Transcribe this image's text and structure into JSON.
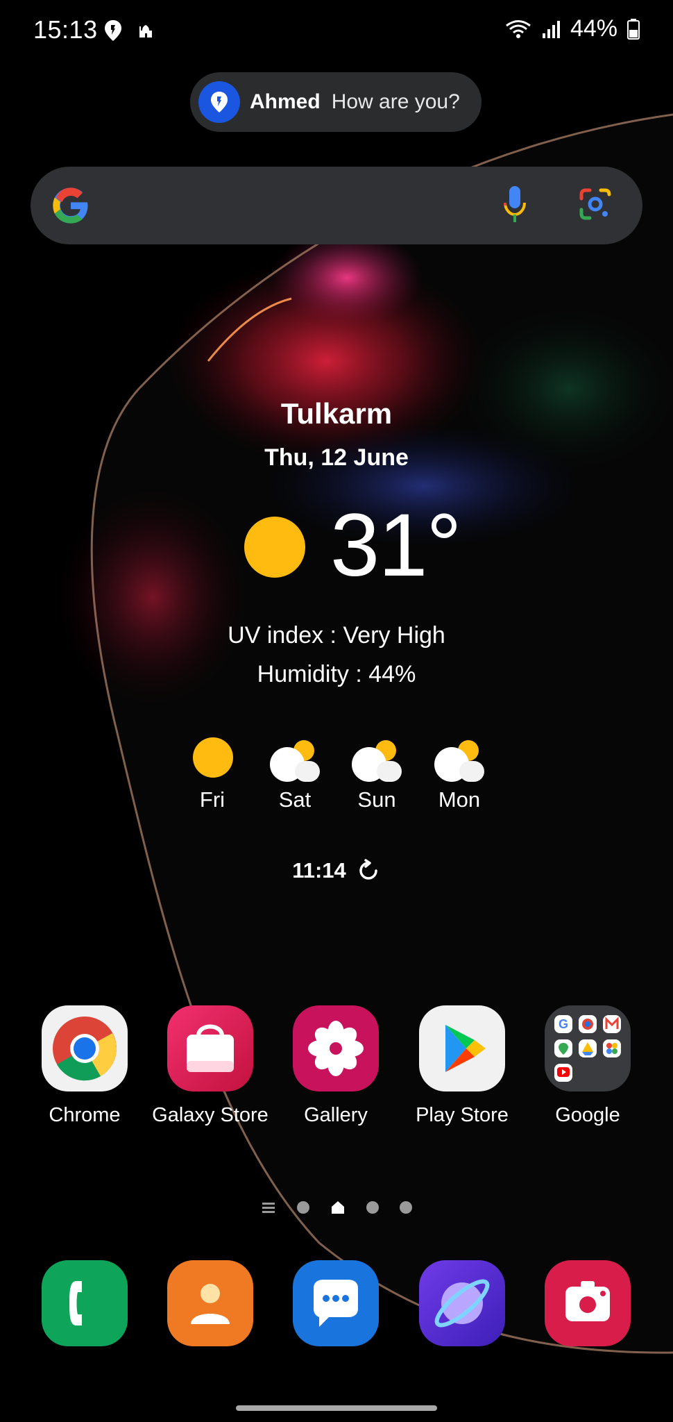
{
  "status_bar": {
    "time": "15:13",
    "battery": "44%",
    "left_icons": [
      "location-pin-icon",
      "mosque-icon"
    ],
    "right_icons": [
      "wifi-icon",
      "signal-icon",
      "battery-icon"
    ]
  },
  "notification": {
    "name": "Ahmed",
    "message": "How are you?",
    "icon": "location-pin-icon"
  },
  "search": {
    "logo": "google-g-logo",
    "mic_icon": "mic-icon",
    "lens_icon": "google-lens-icon"
  },
  "weather": {
    "city": "Tulkarm",
    "date": "Thu, 12 June",
    "temperature": "31°",
    "condition_icon": "sunny-icon",
    "uv": "UV index : Very High",
    "humidity": "Humidity : 44%",
    "forecast": [
      {
        "day": "Fri",
        "icon": "sunny-icon"
      },
      {
        "day": "Sat",
        "icon": "partly-cloudy-icon"
      },
      {
        "day": "Sun",
        "icon": "partly-cloudy-icon"
      },
      {
        "day": "Mon",
        "icon": "partly-cloudy-icon"
      }
    ],
    "updated_time": "11:14",
    "refresh_icon": "refresh-icon"
  },
  "apps": [
    {
      "label": "Chrome",
      "icon": "chrome-icon"
    },
    {
      "label": "Galaxy Store",
      "icon": "galaxy-store-icon"
    },
    {
      "label": "Gallery",
      "icon": "gallery-icon"
    },
    {
      "label": "Play Store",
      "icon": "play-store-icon"
    },
    {
      "label": "Google",
      "icon": "google-folder-icon"
    }
  ],
  "page_indicator": {
    "pages": 4,
    "current": 1
  },
  "dock": [
    {
      "icon": "phone-icon"
    },
    {
      "icon": "contacts-icon"
    },
    {
      "icon": "messages-icon"
    },
    {
      "icon": "internet-icon"
    },
    {
      "icon": "screen-recorder-icon"
    }
  ],
  "colors": {
    "accent_sun": "#ffbb10",
    "search_bg": "#303134",
    "notification_bg": "#2b2c2e"
  }
}
